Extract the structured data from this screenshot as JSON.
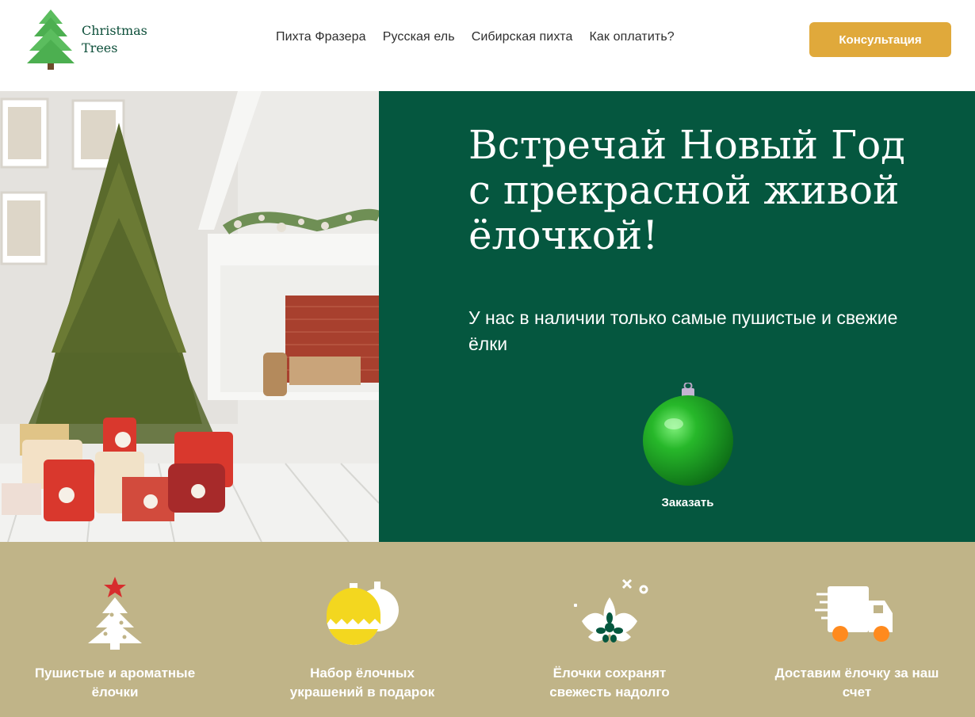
{
  "header": {
    "logo_line1": "Christmas",
    "logo_line2": "Trees",
    "nav": [
      "Пихта Фразера",
      "Русская ель",
      "Сибирская пихта",
      "Как оплатить?"
    ],
    "cta_label": "Консультация"
  },
  "hero": {
    "title_line1": "Встречай Новый Год",
    "title_line2": "с прекрасной живой",
    "title_line3": "ёлочкой!",
    "subtitle": "У нас в наличии только самые пушистые и свежие ёлки",
    "order_label": "Заказать"
  },
  "features": [
    {
      "icon": "christmas-tree-icon",
      "line1": "Пушистые и ароматные",
      "line2": "ёлочки"
    },
    {
      "icon": "ornaments-icon",
      "line1": "Набор ёлочных",
      "line2": "украшений в подарок"
    },
    {
      "icon": "flower-freshness-icon",
      "line1": "Ёлочки сохранят",
      "line2": "свежесть надолго"
    },
    {
      "icon": "delivery-truck-icon",
      "line1": "Доставим ёлочку за наш",
      "line2": "счет"
    }
  ],
  "colors": {
    "brand_green": "#05573f",
    "accent_gold": "#e0a93b",
    "feature_band": "#c0b488",
    "logo_tree": "#4caf50"
  }
}
